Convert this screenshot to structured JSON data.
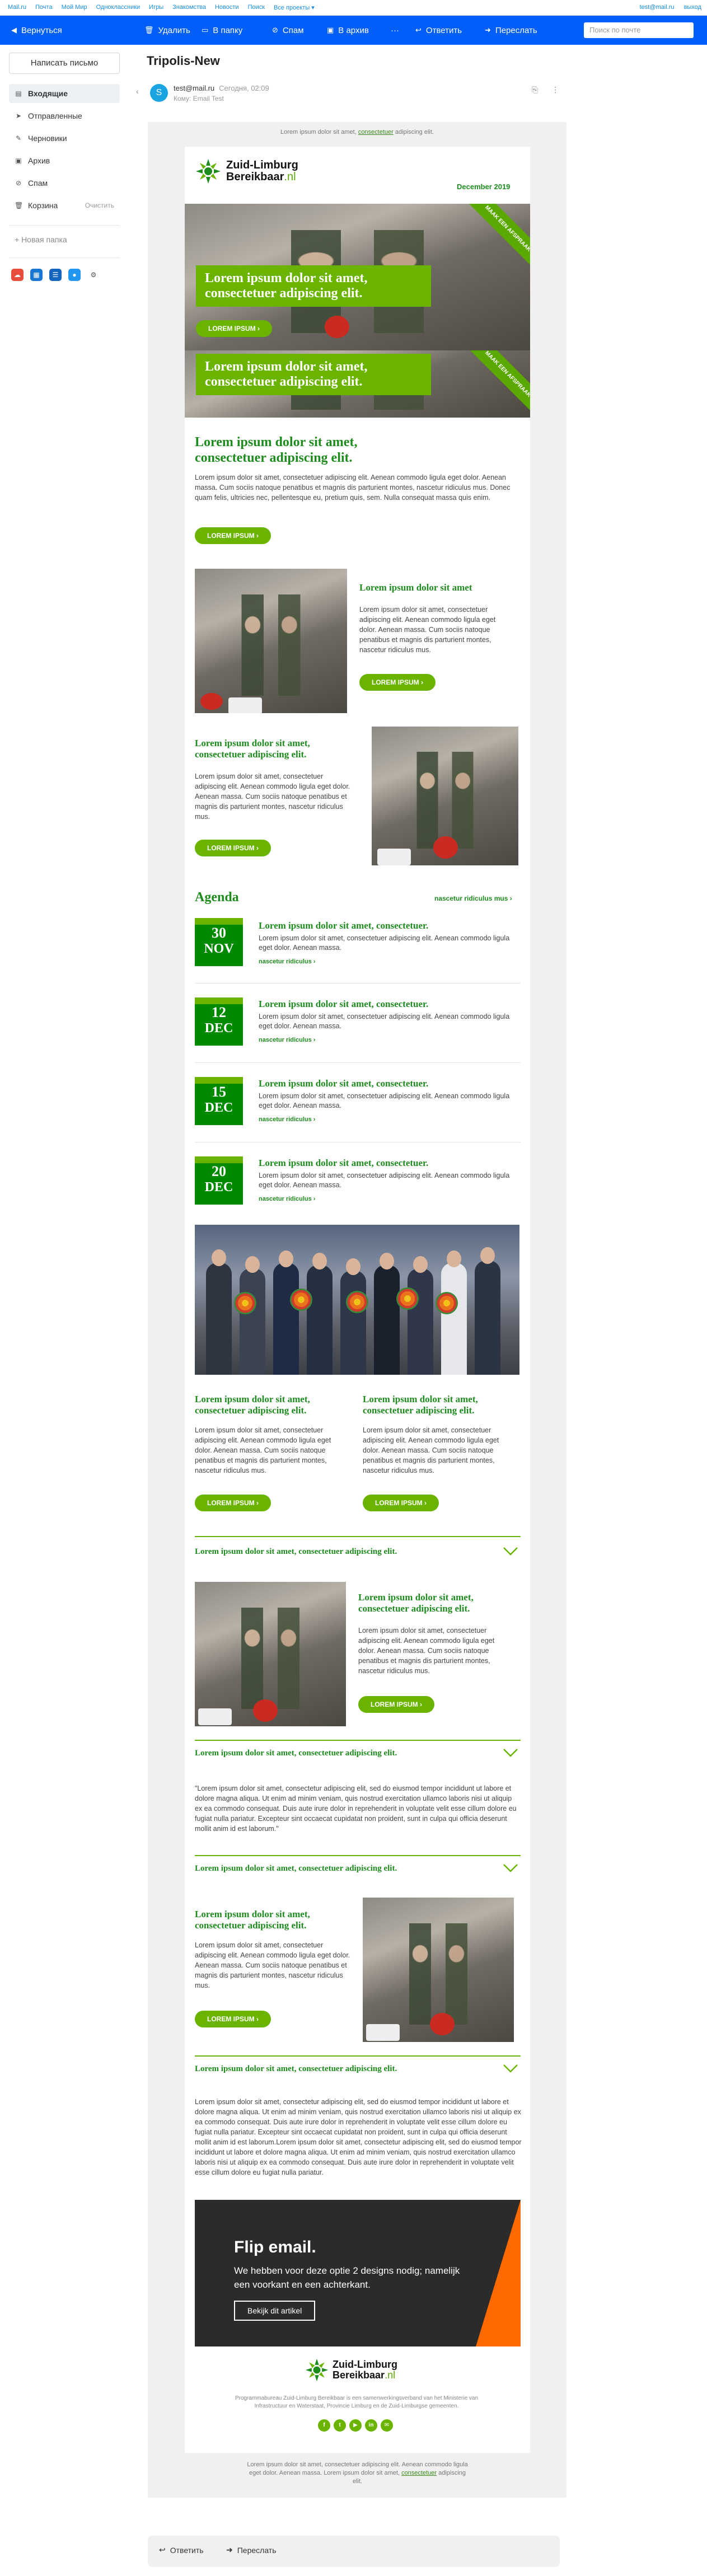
{
  "portal": {
    "links": [
      "Mail.ru",
      "Почта",
      "Мой Мир",
      "Одноклассники",
      "Игры",
      "Знакомства",
      "Новости",
      "Поиск",
      "Все проекты ▾"
    ],
    "account": "test@mail.ru",
    "logout": "выход"
  },
  "toolbar": {
    "back": "Вернуться",
    "delete": "Удалить",
    "to_folder": "В папку",
    "spam": "Спам",
    "archive": "В архив",
    "more": "···",
    "reply": "Ответить",
    "forward": "Переслать",
    "search_placeholder": "Поиск по почте"
  },
  "sidebar": {
    "compose": "Написать письмо",
    "items": [
      {
        "label": "Входящие",
        "icon": "inbox-icon"
      },
      {
        "label": "Отправленные",
        "icon": "sent-icon"
      },
      {
        "label": "Черновики",
        "icon": "draft-icon"
      },
      {
        "label": "Архив",
        "icon": "archive-icon"
      },
      {
        "label": "Спам",
        "icon": "spam-icon"
      },
      {
        "label": "Корзина",
        "icon": "trash-icon",
        "action": "Очистить"
      }
    ],
    "new_folder": "+ Новая папка"
  },
  "mail": {
    "subject": "Tripolis-New",
    "sender": "test@mail.ru",
    "date": "Сегодня, 02:09",
    "to": "Кому: Email Test",
    "avatar_letter": "S"
  },
  "newsletter": {
    "preheader_text": "Lorem ipsum dolor sit amet,",
    "preheader_link": "consectetuer",
    "preheader_tail": "adipiscing elit.",
    "logo_line1": "Zuid-Limburg",
    "logo_line2": "Bereikbaar",
    "logo_tld": ".nl",
    "issue": "December 2019",
    "hero1_title": "Lorem ipsum dolor sit amet, consectetuer adipiscing elit.",
    "hero1_button": "LOREM IPSUM ›",
    "hero2_title": "Lorem ipsum dolor sit amet, consectetuer adipiscing elit.",
    "ribbon": "MAAK EEN AFSPRAAK",
    "intro_title": "Lorem ipsum dolor sit amet, consectetuer adipiscing elit.",
    "intro_text": "Lorem ipsum dolor sit amet, consectetuer adipiscing elit. Aenean commodo ligula eget dolor. Aenean massa. Cum sociis natoque penatibus et magnis dis parturient montes, nascetur ridiculus mus. Donec quam felis, ultricies nec, pellentesque eu, pretium quis, sem. Nulla consequat massa quis enim.",
    "intro_button": "LOREM IPSUM ›",
    "block1_title": "Lorem ipsum dolor sit amet",
    "block1_text": "Lorem ipsum dolor sit amet, consectetuer adipiscing elit. Aenean commodo ligula eget dolor. Aenean massa. Cum sociis natoque penatibus et magnis dis parturient montes, nascetur ridiculus mus.",
    "block1_button": "LOREM IPSUM ›",
    "block2_title": "Lorem ipsum dolor sit amet, consectetuer adipiscing elit.",
    "block2_text": "Lorem ipsum dolor sit amet, consectetuer adipiscing elit. Aenean commodo ligula eget dolor. Aenean massa. Cum sociis natoque penatibus et magnis dis parturient montes, nascetur ridiculus mus.",
    "block2_button": "LOREM IPSUM ›",
    "agenda_title": "Agenda",
    "agenda_more": "nascetur ridiculus mus ›",
    "events": [
      {
        "day": "30",
        "month": "NOV",
        "title": "Lorem ipsum dolor sit amet, consectetuer.",
        "text": "Lorem ipsum dolor sit amet, consectetuer adipiscing elit. Aenean commodo ligula eget dolor. Aenean massa.",
        "link": "nascetur ridiculus ›"
      },
      {
        "day": "12",
        "month": "DEC",
        "title": "Lorem ipsum dolor sit amet, consectetuer.",
        "text": "Lorem ipsum dolor sit amet, consectetuer adipiscing elit. Aenean commodo ligula eget dolor. Aenean massa.",
        "link": "nascetur ridiculus ›"
      },
      {
        "day": "15",
        "month": "DEC",
        "title": "Lorem ipsum dolor sit amet, consectetuer.",
        "text": "Lorem ipsum dolor sit amet, consectetuer adipiscing elit. Aenean commodo ligula eget dolor. Aenean massa.",
        "link": "nascetur ridiculus ›"
      },
      {
        "day": "20",
        "month": "DEC",
        "title": "Lorem ipsum dolor sit amet, consectetuer.",
        "text": "Lorem ipsum dolor sit amet, consectetuer adipiscing elit. Aenean commodo ligula eget dolor. Aenean massa.",
        "link": "nascetur ridiculus ›"
      }
    ],
    "col_left_title": "Lorem ipsum dolor sit amet, consectetuer adipiscing elit.",
    "col_left_text": "Lorem ipsum dolor sit amet, consectetuer adipiscing elit. Aenean commodo ligula eget dolor. Aenean massa. Cum sociis natoque penatibus et magnis dis parturient montes, nascetur ridiculus mus.",
    "col_left_button": "LOREM IPSUM ›",
    "col_right_title": "Lorem ipsum dolor sit amet, consectetuer adipiscing elit.",
    "col_right_text": "Lorem ipsum dolor sit amet, consectetuer adipiscing elit. Aenean commodo ligula eget dolor. Aenean massa. Cum sociis natoque penatibus et magnis dis parturient montes, nascetur ridiculus mus.",
    "col_right_button": "LOREM IPSUM ›",
    "acc1_title": "Lorem ipsum dolor sit amet, consectetuer adipiscing elit.",
    "acc1_inner_title": "Lorem ipsum dolor sit amet, consectetuer adipiscing elit.",
    "acc1_text": "Lorem ipsum dolor sit amet, consectetuer adipiscing elit. Aenean commodo ligula eget dolor. Aenean massa. Cum sociis natoque penatibus et magnis dis parturient montes, nascetur ridiculus mus.",
    "acc1_button": "LOREM IPSUM ›",
    "acc2_title": "Lorem ipsum dolor sit amet, consectetuer adipiscing elit.",
    "acc2_quote": "\"Lorem ipsum dolor sit amet, consectetur adipiscing elit, sed do eiusmod tempor incididunt ut labore et dolore magna aliqua. Ut enim ad minim veniam, quis nostrud exercitation ullamco laboris nisi ut aliquip ex ea commodo consequat. Duis aute irure dolor in reprehenderit in voluptate velit esse cillum dolore eu fugiat nulla pariatur. Excepteur sint occaecat cupidatat non proident, sunt in culpa qui officia deserunt mollit anim id est laborum.\"",
    "acc3_title": "Lorem ipsum dolor sit amet, consectetuer adipiscing elit.",
    "acc3_inner_title": "Lorem ipsum dolor sit amet, consectetuer adipiscing elit.",
    "acc3_text": "Lorem ipsum dolor sit amet, consectetuer adipiscing elit. Aenean commodo ligula eget dolor. Aenean massa. Cum sociis natoque penatibus et magnis dis parturient montes, nascetur ridiculus mus.",
    "acc3_button": "LOREM IPSUM ›",
    "acc4_title": "Lorem ipsum dolor sit amet, consectetuer adipiscing elit.",
    "acc4_text": "Lorem ipsum dolor sit amet, consectetur adipiscing elit, sed do eiusmod tempor incididunt ut labore et dolore magna aliqua. Ut enim ad minim veniam, quis nostrud exercitation ullamco laboris nisi ut aliquip ex ea commodo consequat. Duis aute irure dolor in reprehenderit in voluptate velit esse cillum dolore eu fugiat nulla pariatur. Excepteur sint occaecat cupidatat non proident, sunt in culpa qui officia deserunt mollit anim id est laborum.Lorem ipsum dolor sit amet, consectetur adipiscing elit, sed do eiusmod tempor incididunt ut labore et dolore magna aliqua. Ut enim ad minim veniam, quis nostrud exercitation ullamco laboris nisi ut aliquip ex ea commodo consequat. Duis aute irure dolor in reprehenderit in voluptate velit esse cillum dolore eu fugiat nulla pariatur.",
    "flip_title": "Flip email.",
    "flip_text": "We hebben voor deze optie 2 designs nodig; namelijk een voorkant en een achterkant.",
    "flip_button": "Bekijk dit artikel",
    "footer_text": "Programmabureau Zuid-Limburg Bereikbaar is een samenwerkingsverband van het Ministerie van Infrastructuur en Waterstaat, Provincie Limburg en de Zuid-Limburgse gemeenten.",
    "socials": [
      "f",
      "t",
      "▶",
      "in",
      "✉"
    ],
    "post_text": "Lorem ipsum dolor sit amet, consectetuer adipiscing elit. Aenean commodo ligula eget dolor. Aenean massa. Lorem ipsum dolor sit amet,",
    "post_link": "consectetuer",
    "post_tail": "adipiscing elit."
  },
  "reply_bar": {
    "reply": "Ответить",
    "forward": "Переслать"
  },
  "colors": {
    "toolbar": "#005ff9",
    "brand_green": "#6ab400",
    "dark_green": "#1e8b1e",
    "date_green": "#008a00",
    "flip_dark": "#2b2b2b",
    "flip_orange": "#ff6a00"
  }
}
